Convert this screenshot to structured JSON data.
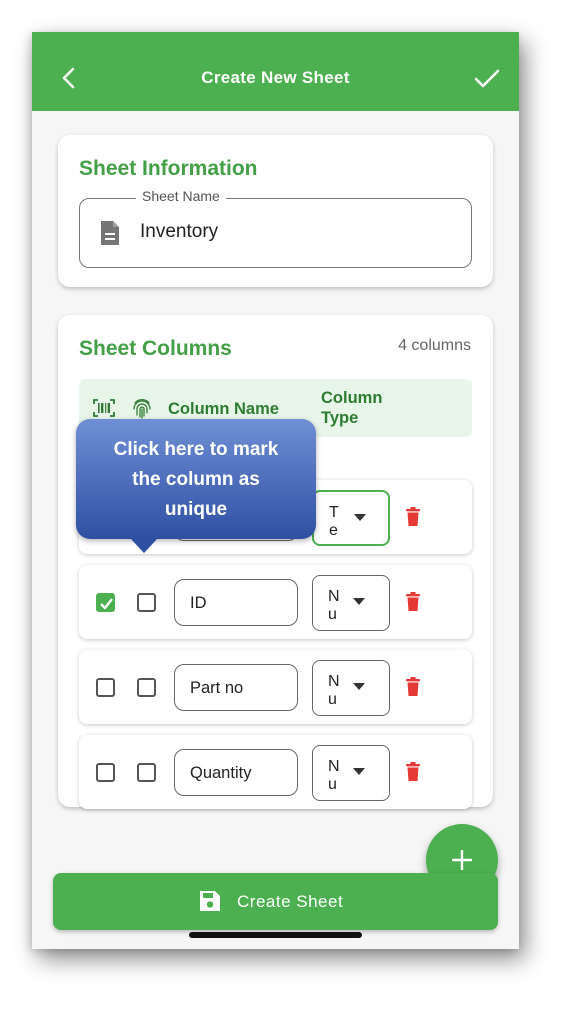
{
  "appbar": {
    "title": "Create New Sheet",
    "back_icon": "arrow-back-icon",
    "confirm_icon": "check-icon"
  },
  "sheet_info": {
    "title": "Sheet Information",
    "field_label": "Sheet Name",
    "field_value": "Inventory",
    "field_icon": "document-icon"
  },
  "columns": {
    "title": "Sheet Columns",
    "count": "4 columns",
    "header": {
      "barcode_icon": "barcode-icon",
      "unique_icon": "fingerprint-icon",
      "name": "Column Name",
      "type": "Column Type"
    },
    "rows": [
      {
        "barcode": false,
        "unique": false,
        "name": "",
        "type": "T\ne",
        "focused": true
      },
      {
        "barcode": true,
        "unique": false,
        "name": "ID",
        "type": "N\nu"
      },
      {
        "barcode": false,
        "unique": false,
        "name": "Part no",
        "type": "N\nu"
      },
      {
        "barcode": false,
        "unique": false,
        "name": "Quantity",
        "type": "N\nu"
      }
    ]
  },
  "tooltip": {
    "line1": "Click here to mark",
    "line2": "the column as",
    "line3": "unique"
  },
  "fab": {
    "icon": "plus-icon"
  },
  "create_button": {
    "label": "Create Sheet",
    "icon": "save-icon"
  },
  "colors": {
    "primary": "#4caf50",
    "title_green": "#43a047",
    "delete_red": "#e53935",
    "tooltip_blue": "#3f5fb5"
  }
}
